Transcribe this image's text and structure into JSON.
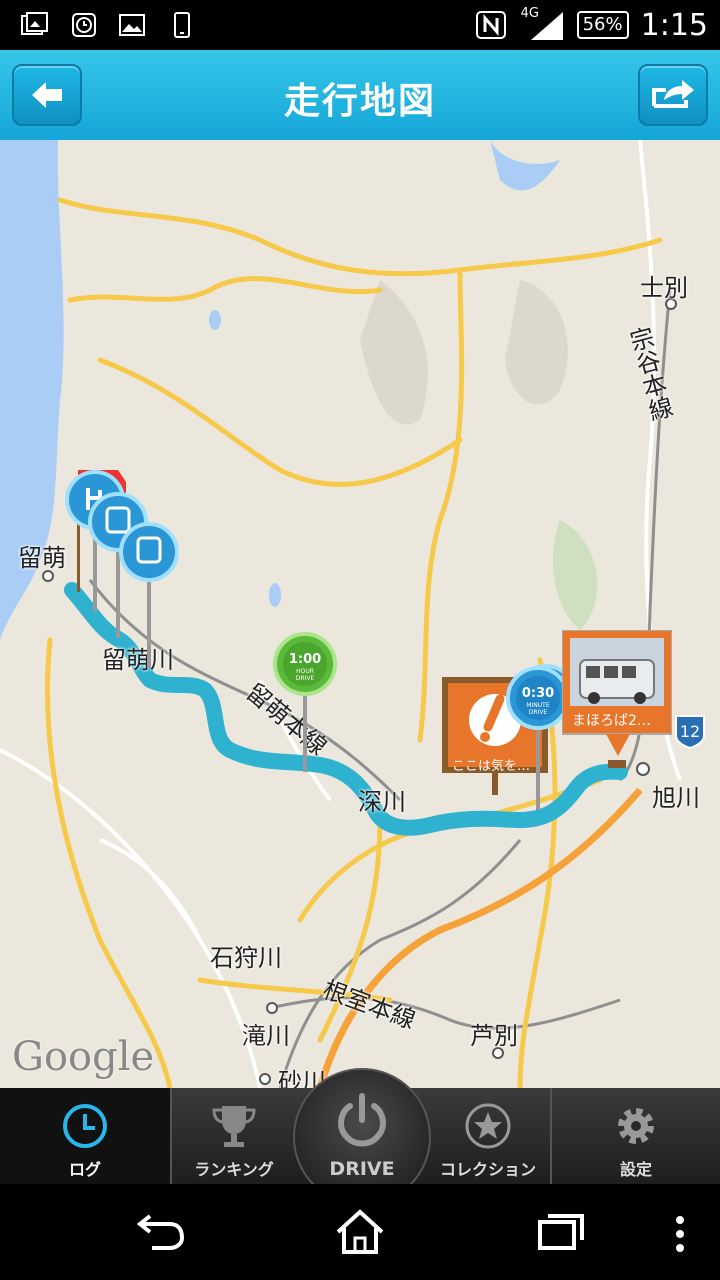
{
  "status_bar": {
    "network": "4G",
    "battery": "56%",
    "time": "1:15"
  },
  "header": {
    "title": "走行地図",
    "back_icon": "arrow-left-icon",
    "share_icon": "share-arrow-icon"
  },
  "map": {
    "places": {
      "rumoi": "留萌",
      "rumoigawa": "留萌川",
      "shibetsu": "士別",
      "asahikawa": "旭川",
      "ishikarigawa": "石狩川",
      "takikawa": "滝川",
      "ashibetsu": "芦別",
      "sunagawa": "砂川",
      "fukagawa": "深川"
    },
    "railways": {
      "soya_line": "宗谷本線",
      "rumoi_line": "留萌本線",
      "nemuro_line": "根室本線"
    },
    "route_shield": "12",
    "attribution": "Google",
    "markers": {
      "hour_drive_time": "1:00",
      "hour_drive_unit": "HOUR",
      "hour_drive_word": "DRIVE",
      "minute_drive_time": "0:30",
      "minute_drive_unit": "MINUTE",
      "minute_drive_word": "DRIVE",
      "caution_sign_text": "ここは気を…",
      "photo_caption": "まほろば2…"
    }
  },
  "tabs": {
    "log": "ログ",
    "ranking": "ランキング",
    "drive": "DRIVE",
    "collection": "コレクション",
    "settings": "設定"
  },
  "colors": {
    "header": "#1eb4e4",
    "route": "#2eb2cf",
    "highway": "#f6c94a",
    "sign_orange": "#e8762a",
    "active_tab_icon": "#2ab6ea"
  }
}
